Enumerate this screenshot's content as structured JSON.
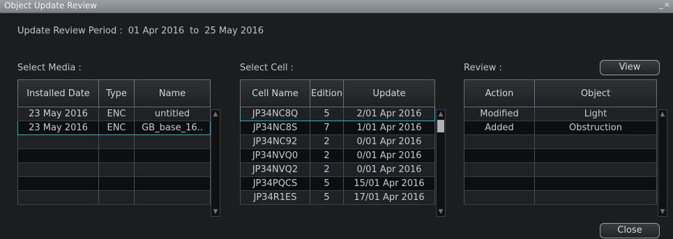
{
  "window": {
    "title": "Object Update Review",
    "controls": "_×"
  },
  "period": {
    "label": "Update Review Period :",
    "from": "01 Apr 2016",
    "to_label": "to",
    "to": "25 May 2016"
  },
  "media": {
    "label": "Select Media :",
    "headers": [
      "Installed Date",
      "Type",
      "Name"
    ],
    "rows": [
      [
        "23 May 2016",
        "ENC",
        "untitled"
      ],
      [
        "23 May 2016",
        "ENC",
        "GB_base_16.."
      ]
    ]
  },
  "cell": {
    "label": "Select Cell :",
    "headers": [
      "Cell Name",
      "Edition",
      "Update"
    ],
    "rows": [
      [
        "JP34NC8Q",
        "5",
        "2/01 Apr 2016"
      ],
      [
        "JP34NC8S",
        "7",
        "1/01 Apr 2016"
      ],
      [
        "JP34NC92",
        "2",
        "0/01 Apr 2016"
      ],
      [
        "JP34NVQ0",
        "2",
        "0/01 Apr 2016"
      ],
      [
        "JP34NVQ2",
        "2",
        "0/01 Apr 2016"
      ],
      [
        "JP34PQCS",
        "5",
        "15/01 Apr 2016"
      ],
      [
        "JP34R1ES",
        "5",
        "17/01 Apr 2016"
      ]
    ]
  },
  "review": {
    "label": "Review :",
    "headers": [
      "Action",
      "Object"
    ],
    "rows": [
      [
        "Modified",
        "Light"
      ],
      [
        "Added",
        "Obstruction"
      ]
    ]
  },
  "buttons": {
    "view": "View",
    "close": "Close"
  },
  "icons": {
    "up": "▲",
    "down": "▼"
  }
}
